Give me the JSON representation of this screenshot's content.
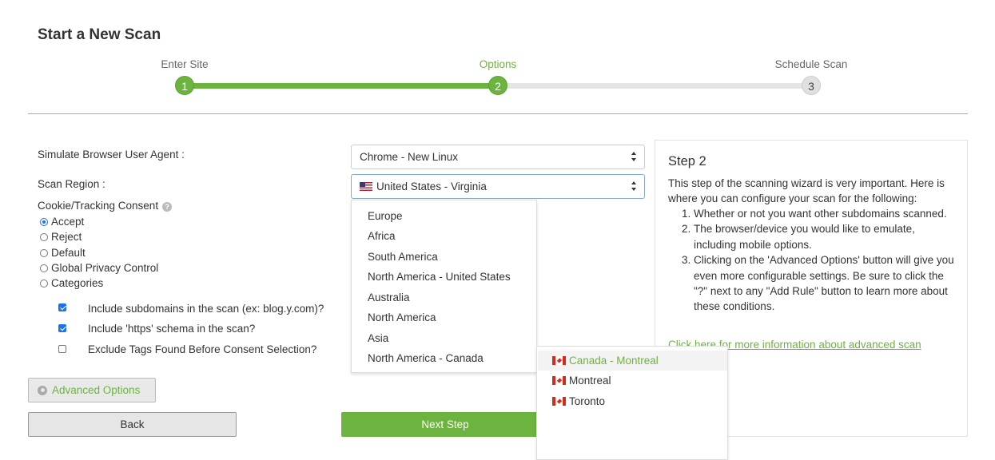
{
  "page": {
    "title": "Start a New Scan"
  },
  "wizard": {
    "steps": [
      {
        "label": "Enter Site",
        "number": "1",
        "state": "done"
      },
      {
        "label": "Options",
        "number": "2",
        "state": "active"
      },
      {
        "label": "Schedule Scan",
        "number": "3",
        "state": "todo"
      }
    ],
    "progress": 0.5
  },
  "form": {
    "user_agent": {
      "label": "Simulate Browser User Agent :",
      "value": "Chrome - New Linux"
    },
    "scan_region": {
      "label": "Scan Region :",
      "value": "United States - Virginia"
    },
    "consent": {
      "label": "Cookie/Tracking Consent",
      "options": [
        "Accept",
        "Reject",
        "Default",
        "Global Privacy Control",
        "Categories"
      ],
      "selected": "Accept"
    },
    "checks": [
      {
        "label": "Include subdomains in the scan (ex: blog.y.com)?",
        "checked": true
      },
      {
        "label": "Include 'https' schema in the scan?",
        "checked": true
      },
      {
        "label": "Exclude Tags Found Before Consent Selection?",
        "checked": false
      }
    ]
  },
  "region_menu": {
    "options": [
      "Europe",
      "Africa",
      "South America",
      "North America - United States",
      "Australia",
      "North America",
      "Asia",
      "North America - Canada"
    ],
    "submenu": [
      "Canada - Montreal",
      "Montreal",
      "Toronto"
    ]
  },
  "buttons": {
    "advanced": "Advanced Options",
    "back": "Back",
    "next": "Next Step"
  },
  "info": {
    "title": "Step 2",
    "intro": "This step of the scanning wizard is very important. Here is where you can configure your scan for the following:",
    "items": [
      "Whether or not you want other subdomains scanned.",
      "The browser/device you would like to emulate, including mobile options.",
      "Clicking on the 'Advanced Options' button will give you even more configurable settings. Be sure to click the \"?\" next to any \"Add Rule\" button to learn more about these conditions."
    ],
    "link": "Click here for more information about advanced scan"
  },
  "colors": {
    "accent": "#6db33f",
    "track_inactive": "#e5e5e5"
  }
}
